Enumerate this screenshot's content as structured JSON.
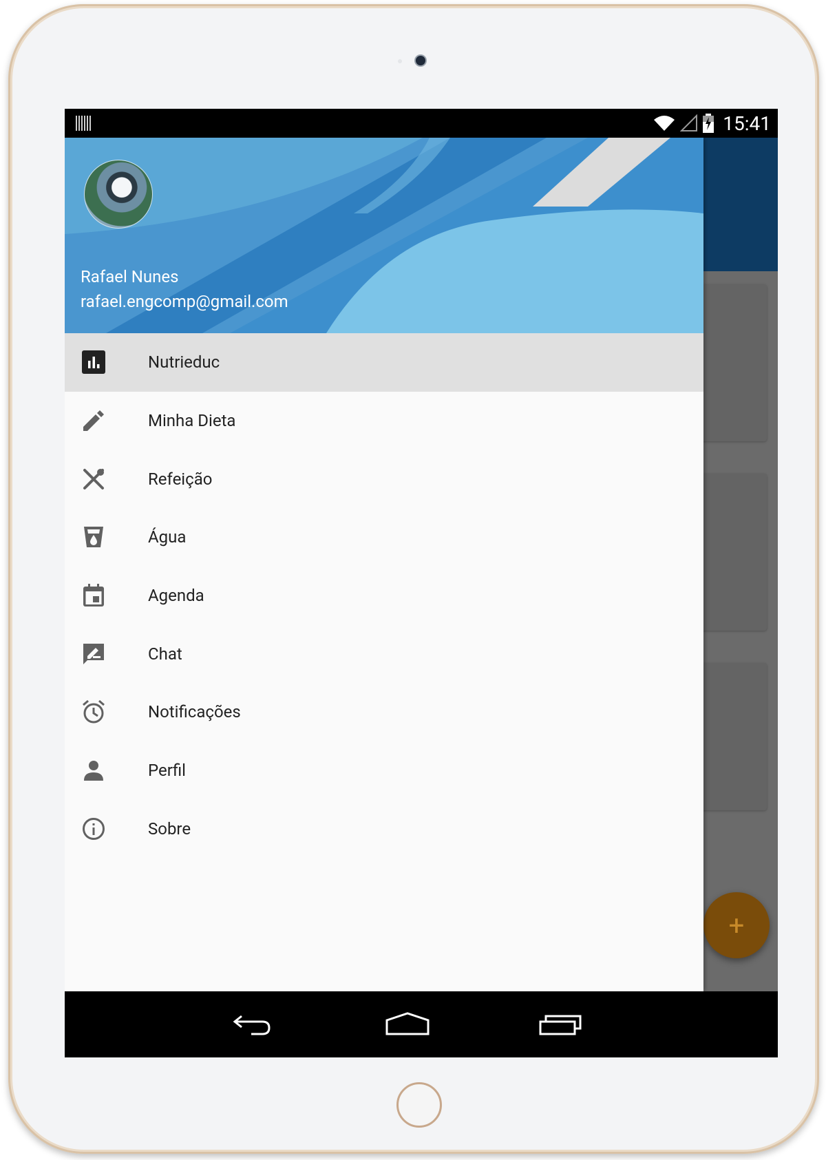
{
  "status_bar": {
    "time": "15:41",
    "icons": [
      "barcode-icon",
      "wifi-icon",
      "signal-icon",
      "battery-icon"
    ]
  },
  "drawer": {
    "header": {
      "user_name": "Rafael Nunes",
      "user_email": "rafael.engcomp@gmail.com"
    },
    "items": [
      {
        "label": "Nutrieduc",
        "icon": "bar-chart-icon",
        "selected": true
      },
      {
        "label": "Minha Dieta",
        "icon": "pencil-icon",
        "selected": false
      },
      {
        "label": "Refeição",
        "icon": "utensils-icon",
        "selected": false
      },
      {
        "label": "Água",
        "icon": "water-cup-icon",
        "selected": false
      },
      {
        "label": "Agenda",
        "icon": "calendar-icon",
        "selected": false
      },
      {
        "label": "Chat",
        "icon": "chat-icon",
        "selected": false
      },
      {
        "label": "Notificações",
        "icon": "alarm-icon",
        "selected": false
      },
      {
        "label": "Perfil",
        "icon": "person-icon",
        "selected": false
      },
      {
        "label": "Sobre",
        "icon": "info-icon",
        "selected": false
      }
    ]
  },
  "fab": {
    "label": "+"
  },
  "colors": {
    "app_bar": "#0d3b63",
    "header": "#5aa7d6",
    "selected_item": "#e0e0e0",
    "fab": "#7a4c0a"
  }
}
